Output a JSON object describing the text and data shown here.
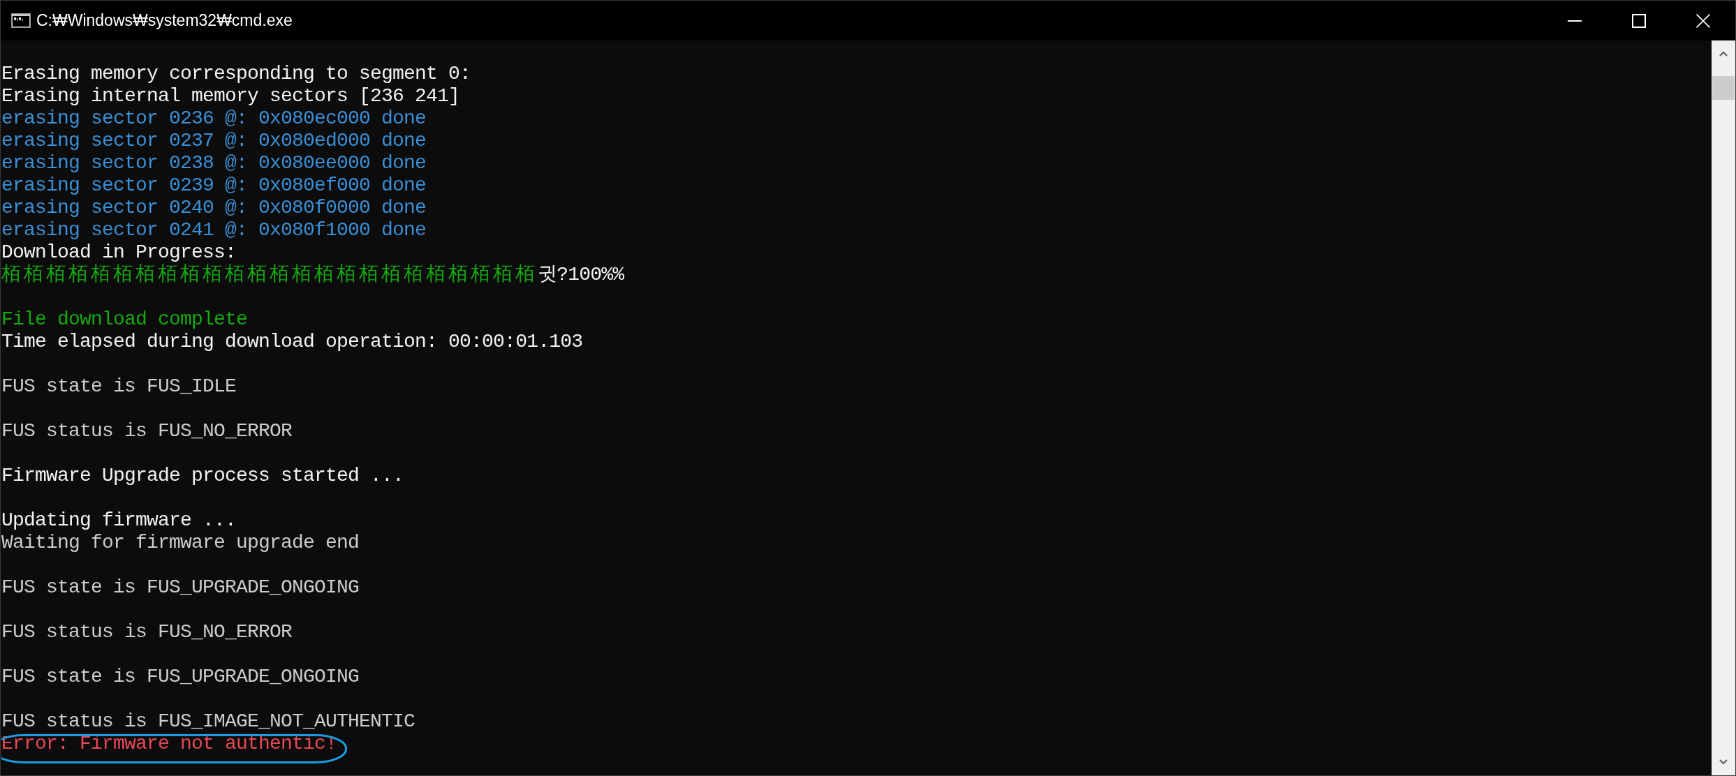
{
  "window": {
    "title": "C:₩Windows₩system32₩cmd.exe"
  },
  "console": {
    "blocks": [
      {
        "lines": [
          {
            "kind": "text",
            "text": "Erasing memory corresponding to segment 0:",
            "color": "#f2f2f2",
            "circled": false
          },
          {
            "kind": "text",
            "text": "Erasing internal memory sectors [236 241]",
            "color": "#f2f2f2",
            "circled": false
          },
          {
            "kind": "text",
            "text": "erasing sector 0236 @: 0x080ec000 done",
            "color": "#3a8fd6",
            "circled": false
          },
          {
            "kind": "text",
            "text": "erasing sector 0237 @: 0x080ed000 done",
            "color": "#3a8fd6",
            "circled": false
          },
          {
            "kind": "text",
            "text": "erasing sector 0238 @: 0x080ee000 done",
            "color": "#3a8fd6",
            "circled": false
          },
          {
            "kind": "text",
            "text": "erasing sector 0239 @: 0x080ef000 done",
            "color": "#3a8fd6",
            "circled": false
          },
          {
            "kind": "text",
            "text": "erasing sector 0240 @: 0x080f0000 done",
            "color": "#3a8fd6",
            "circled": false
          },
          {
            "kind": "text",
            "text": "erasing sector 0241 @: 0x080f1000 done",
            "color": "#3a8fd6",
            "circled": false
          },
          {
            "kind": "text",
            "text": "Download in Progress:",
            "color": "#f2f2f2",
            "circled": false
          },
          {
            "kind": "progress",
            "parts": [
              {
                "text": "栢栢栢栢栢栢栢栢栢栢栢栢栢栢栢栢栢栢栢栢栢栢栢栢",
                "color": "#16a80f"
              },
              {
                "text": "귓?100%%",
                "color": "#f2f2f2"
              }
            ],
            "circled": false
          }
        ]
      },
      {
        "lines": [
          {
            "kind": "text",
            "text": "File download complete",
            "color": "#16a80f",
            "circled": false
          },
          {
            "kind": "text",
            "text": "Time elapsed during download operation: 00:00:01.103",
            "color": "#f2f2f2",
            "circled": false
          }
        ]
      },
      {
        "lines": [
          {
            "kind": "text",
            "text": "FUS state is FUS_IDLE",
            "color": "#cccccc",
            "circled": false
          }
        ]
      },
      {
        "lines": [
          {
            "kind": "text",
            "text": "FUS status is FUS_NO_ERROR",
            "color": "#cccccc",
            "circled": false
          }
        ]
      },
      {
        "lines": [
          {
            "kind": "text",
            "text": "Firmware Upgrade process started ...",
            "color": "#f2f2f2",
            "circled": false
          }
        ]
      },
      {
        "lines": [
          {
            "kind": "text",
            "text": "Updating firmware ...",
            "color": "#f2f2f2",
            "circled": false
          },
          {
            "kind": "text",
            "text": "Waiting for firmware upgrade end",
            "color": "#cccccc",
            "circled": false
          }
        ]
      },
      {
        "lines": [
          {
            "kind": "text",
            "text": "FUS state is FUS_UPGRADE_ONGOING",
            "color": "#cccccc",
            "circled": false
          }
        ]
      },
      {
        "lines": [
          {
            "kind": "text",
            "text": "FUS status is FUS_NO_ERROR",
            "color": "#cccccc",
            "circled": false
          }
        ]
      },
      {
        "lines": [
          {
            "kind": "text",
            "text": "FUS state is FUS_UPGRADE_ONGOING",
            "color": "#cccccc",
            "circled": false
          }
        ]
      },
      {
        "lines": [
          {
            "kind": "text",
            "text": "FUS status is FUS_IMAGE_NOT_AUTHENTIC",
            "color": "#cccccc",
            "circled": false
          },
          {
            "kind": "text",
            "text": "Error: Firmware not authentic!",
            "color": "#e74856",
            "circled": true
          }
        ]
      }
    ]
  }
}
